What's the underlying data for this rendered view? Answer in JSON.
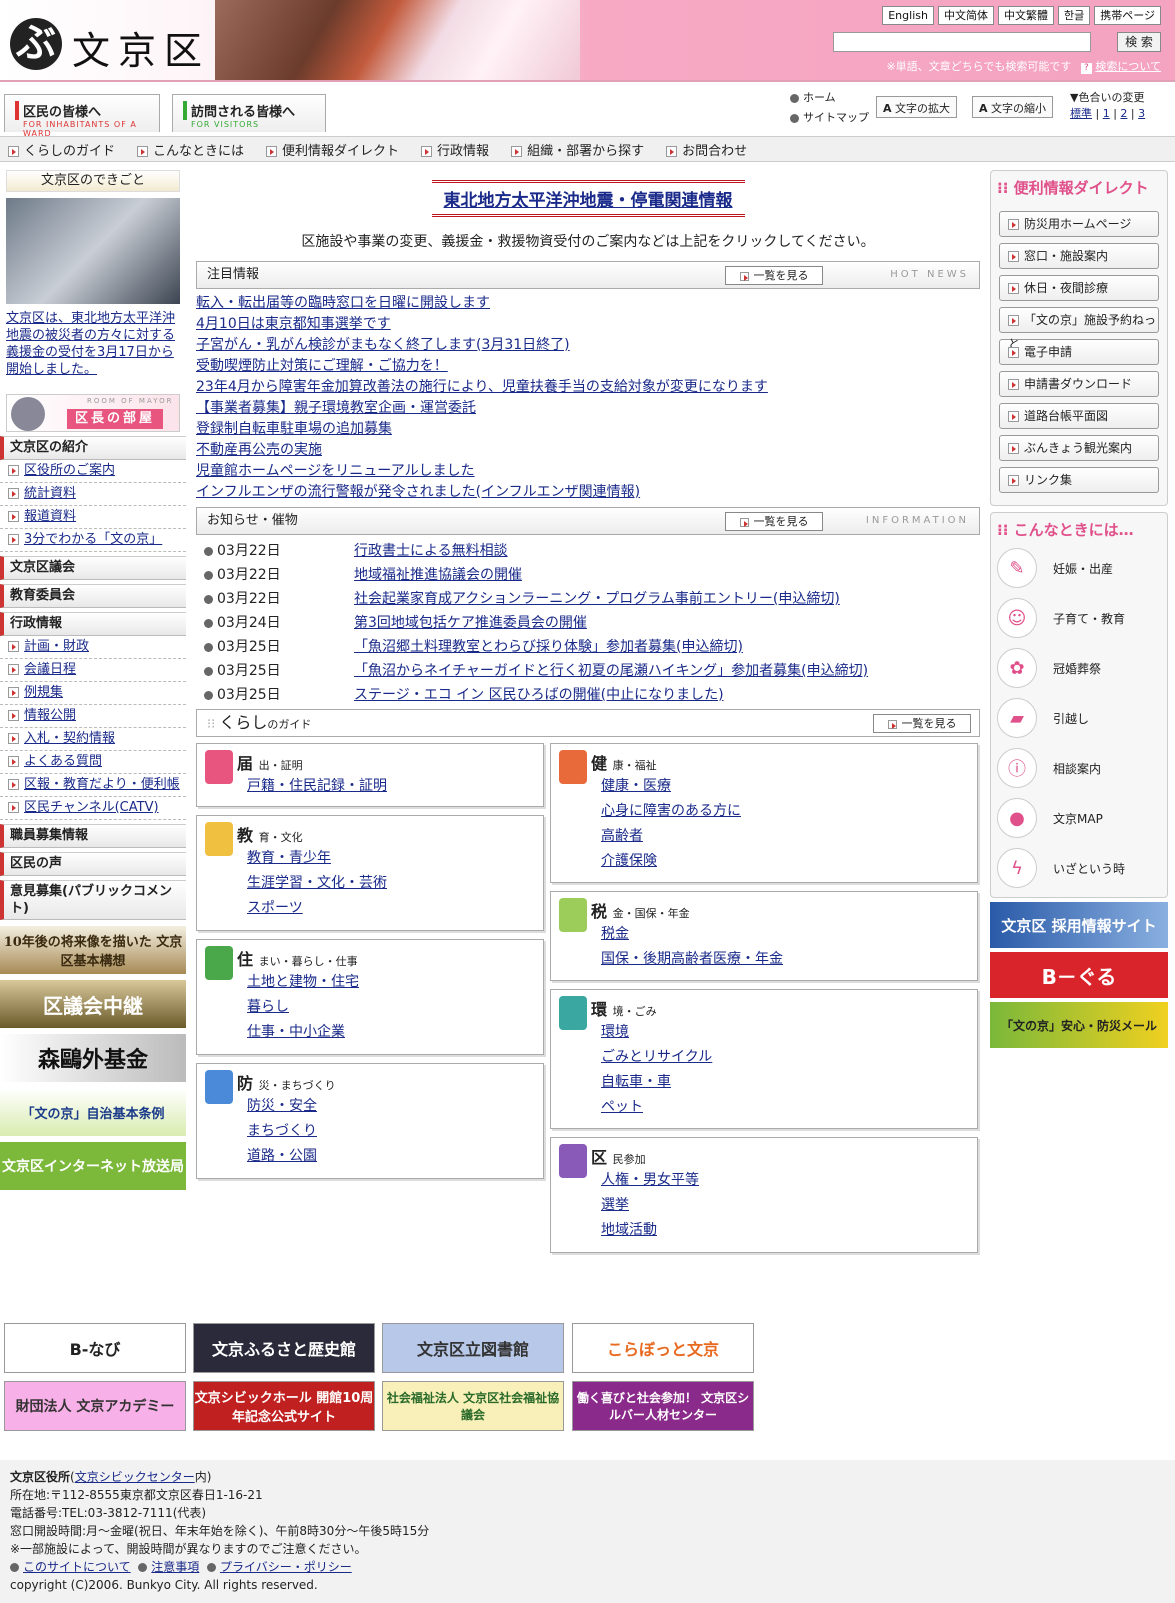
{
  "header": {
    "logo_text": "文京区",
    "langs": [
      "English",
      "中文简体",
      "中文繁體",
      "한글",
      "携帯ページ"
    ],
    "search_placeholder": "",
    "search_button": "検 索",
    "search_note": "※単語、文章どちらでも検索可能です",
    "search_help": "検索について"
  },
  "tabs": {
    "residents": "区民の皆様へ",
    "residents_en": "FOR INHABITANTS OF A WARD",
    "visitors": "訪問される皆様へ",
    "visitors_en": "FOR VISITORS",
    "home": "ホーム",
    "sitemap": "サイトマップ",
    "enlarge": "文字の拡大",
    "shrink": "文字の縮小",
    "color_change": "▼色合いの変更",
    "color_opts": [
      "標準",
      "1",
      "2",
      "3"
    ]
  },
  "guide_nav": [
    "くらしのガイド",
    "こんなときには",
    "便利情報ダイレクト",
    "行政情報",
    "組織・部署から探す",
    "お問合わせ"
  ],
  "left": {
    "events_title": "文京区のできごと",
    "event_text": "文京区は、東北地方太平洋沖地震の被災者の方々に対する義援金の受付を3月17日から開始しました。",
    "mayor_en": "ROOM OF MAYOR",
    "mayor": "区長の部屋",
    "intro": "文京区の紹介",
    "intro_items": [
      "区役所のご案内",
      "統計資料",
      "報道資料",
      "3分でわかる「文の京」"
    ],
    "council": "文京区議会",
    "education": "教育委員会",
    "admin": "行政情報",
    "admin_items": [
      "計画・財政",
      "会議日程",
      "例規集",
      "情報公開",
      "入札・契約情報",
      "よくある質問",
      "区報・教育だより・便利帳",
      "区民チャンネル(CATV)"
    ],
    "jobs": "職員募集情報",
    "voice": "区民の声",
    "opinion": "意見募集(パブリックコメント)",
    "banners": [
      "10年後の将来像を描いた 文京区基本構想",
      "区議会中継",
      "森鷗外基金",
      "「文の京」自治基本条例",
      "文京区インターネット放送局"
    ]
  },
  "center": {
    "quake_link": "東北地方太平洋沖地震・停電関連情報",
    "quake_note": "区施設や事業の変更、義援金・救援物資受付のご案内などは上記をクリックしてください。",
    "hot_title": "注目情報",
    "more": "一覧を見る",
    "hot_en": "HOT NEWS",
    "hot_items": [
      "転入・転出届等の臨時窓口を日曜に開設します",
      "4月10日は東京都知事選挙です",
      "子宮がん・乳がん検診がまもなく終了します(3月31日終了)",
      "受動喫煙防止対策にご理解・ご協力を！",
      "23年4月から障害年金加算改善法の施行により、児童扶養手当の支給対象が変更になります",
      "【事業者募集】親子環境教室企画・運営委託",
      "登録制自転車駐車場の追加募集",
      "不動産再公売の実施",
      "児童館ホームページをリニューアルしました",
      "インフルエンザの流行警報が発令されました(インフルエンザ関連情報)"
    ],
    "info_title": "お知らせ・催物",
    "info_en": "INFORMATION",
    "info_items": [
      {
        "date": "03月22日",
        "text": "行政書士による無料相談"
      },
      {
        "date": "03月22日",
        "text": "地域福祉推進協議会の開催"
      },
      {
        "date": "03月22日",
        "text": "社会起業家育成アクションラーニング・プログラム事前エントリー(申込締切)"
      },
      {
        "date": "03月24日",
        "text": "第3回地域包括ケア推進委員会の開催"
      },
      {
        "date": "03月25日",
        "text": "「魚沼郷土料理教室とわらび採り体験」参加者募集(申込締切)"
      },
      {
        "date": "03月25日",
        "text": "「魚沼からネイチャーガイドと行く初夏の尾瀬ハイキング」参加者募集(申込締切)"
      },
      {
        "date": "03月25日",
        "text": "ステージ・エコ イン 区民ひろばの開催(中止になりました)"
      }
    ],
    "guide_title": "くらし",
    "guide_sub": "のガイド",
    "boxes": {
      "todoke": {
        "head": "届",
        "sub": "出・証明",
        "links": [
          "戸籍・住民記録・証明"
        ]
      },
      "kyo": {
        "head": "教",
        "sub": "育・文化",
        "links": [
          "教育・青少年",
          "生涯学習・文化・芸術",
          "スポーツ"
        ]
      },
      "sumai": {
        "head": "住",
        "sub": "まい・暮らし・仕事",
        "links": [
          "土地と建物・住宅",
          "暮らし",
          "仕事・中小企業"
        ]
      },
      "bou": {
        "head": "防",
        "sub": "災・まちづくり",
        "links": [
          "防災・安全",
          "まちづくり",
          "道路・公園"
        ]
      },
      "ken": {
        "head": "健",
        "sub": "康・福祉",
        "links": [
          "健康・医療",
          "心身に障害のある方に",
          "高齢者",
          "介護保険"
        ]
      },
      "zei": {
        "head": "税",
        "sub": "金・国保・年金",
        "links": [
          "税金",
          "国保・後期高齢者医療・年金"
        ]
      },
      "kan": {
        "head": "環",
        "sub": "境・ごみ",
        "links": [
          "環境",
          "ごみとリサイクル",
          "自転車・車",
          "ペット"
        ]
      },
      "kumin": {
        "head": "区",
        "sub": "民参加",
        "links": [
          "人権・男女平等",
          "選挙",
          "地域活動"
        ]
      }
    }
  },
  "right": {
    "direct_title": "便利情報ダイレクト",
    "direct_items": [
      "防災用ホームページ",
      "窓口・施設案内",
      "休日・夜間診療",
      "「文の京」施設予約ねっと",
      "電子申請",
      "申請書ダウンロード",
      "道路台帳平面図",
      "ぶんきょう観光案内",
      "リンク集"
    ],
    "when_title": "こんなときには…",
    "when_items": [
      "妊娠・出産",
      "子育て・教育",
      "冠婚葬祭",
      "引越し",
      "相談案内",
      "文京MAP",
      "いざという時"
    ],
    "banners": [
      "文京区 採用情報サイト",
      "B－ぐる",
      "「文の京」安心・防災メール"
    ]
  },
  "bottom_banners": [
    "B-なび",
    "文京ふるさと歴史館",
    "文京区立図書館",
    "こらぼっと文京",
    "財団法人 文京アカデミー",
    "文京シビックホール 開館10周年記念公式サイト",
    "社会福祉法人 文京区社会福祉協議会",
    "働く喜びと社会参加！ 文京区シルバー人材センター"
  ],
  "footer": {
    "office": "文京区役所",
    "civic": "文京シビックセンター",
    "civic_suffix": "内)",
    "address": "所在地:〒112-8555東京都文京区春日1-16-21",
    "tel": "電話番号:TEL:03-3812-7111(代表)",
    "hours": "窓口開設時間:月～金曜(祝日、年末年始を除く)、午前8時30分～午後5時15分",
    "note": "※一部施設によって、開設時間が異なりますのでご注意ください。",
    "links": [
      "このサイトについて",
      "注意事項",
      "プライバシー・ポリシー"
    ],
    "copyright": "copyright (C)2006. Bunkyo City. All rights reserved."
  },
  "colors": {
    "accent_pink": "#e0508a",
    "link": "#1a2a8a",
    "quake": "#c0141e"
  }
}
